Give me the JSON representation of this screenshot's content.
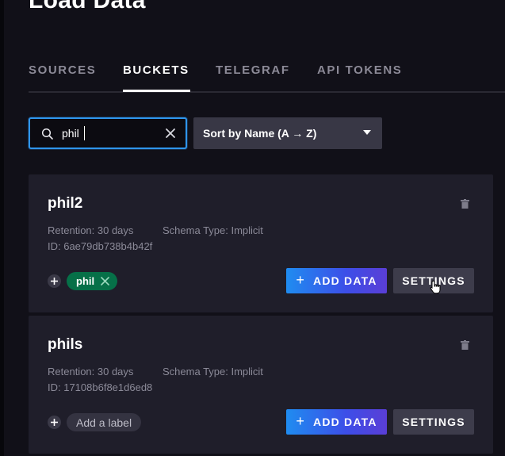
{
  "page": {
    "title": "Load Data"
  },
  "tabs": [
    {
      "label": "SOURCES",
      "active": false
    },
    {
      "label": "BUCKETS",
      "active": true
    },
    {
      "label": "TELEGRAF",
      "active": false
    },
    {
      "label": "API TOKENS",
      "active": false
    }
  ],
  "search": {
    "value": "phil",
    "icon": "search-icon",
    "clear_icon": "close-icon"
  },
  "sort": {
    "selected": "Sort by Name (A → Z)",
    "icon": "chevron-down-icon"
  },
  "buckets": [
    {
      "name": "phil2",
      "retention": "Retention: 30 days",
      "schema": "Schema Type: Implicit",
      "id": "ID: 6ae79db738b4b42f",
      "labels": [
        "phil"
      ],
      "add_label_text": "",
      "add_data_label": "ADD DATA",
      "settings_label": "SETTINGS"
    },
    {
      "name": "phils",
      "retention": "Retention: 30 days",
      "schema": "Schema Type: Implicit",
      "id": "ID: 17108b6f8e1d6ed8",
      "labels": [],
      "add_label_text": "Add a label",
      "add_data_label": "ADD DATA",
      "settings_label": "SETTINGS"
    }
  ],
  "colors": {
    "accent_blue": "#2f95ec",
    "label_green": "#067048",
    "card_bg": "#1f1e2a"
  }
}
